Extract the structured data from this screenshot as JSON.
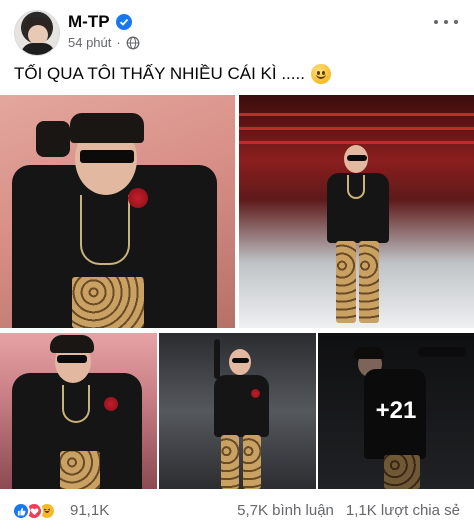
{
  "post": {
    "author": "M-TP",
    "time": "54 phút",
    "caption": "TỐI QUA TÔI THẤY NHIỀU CÁI KÌ .....",
    "icons": {
      "verified": "verified-badge-icon",
      "audience": "globe-icon",
      "more": "more-options-icon",
      "caption_emoji": "smiling-face-emoji"
    }
  },
  "photos": {
    "more_overlay": "+21"
  },
  "footer": {
    "reaction_icons": [
      "like-icon",
      "love-icon",
      "haha-icon"
    ],
    "reaction_count": "91,1K",
    "comments": "5,7K bình luận",
    "shares": "1,1K lượt chia sẻ"
  },
  "colors": {
    "accent": "#1877f2",
    "text": "#050505",
    "secondary": "#65676b"
  }
}
